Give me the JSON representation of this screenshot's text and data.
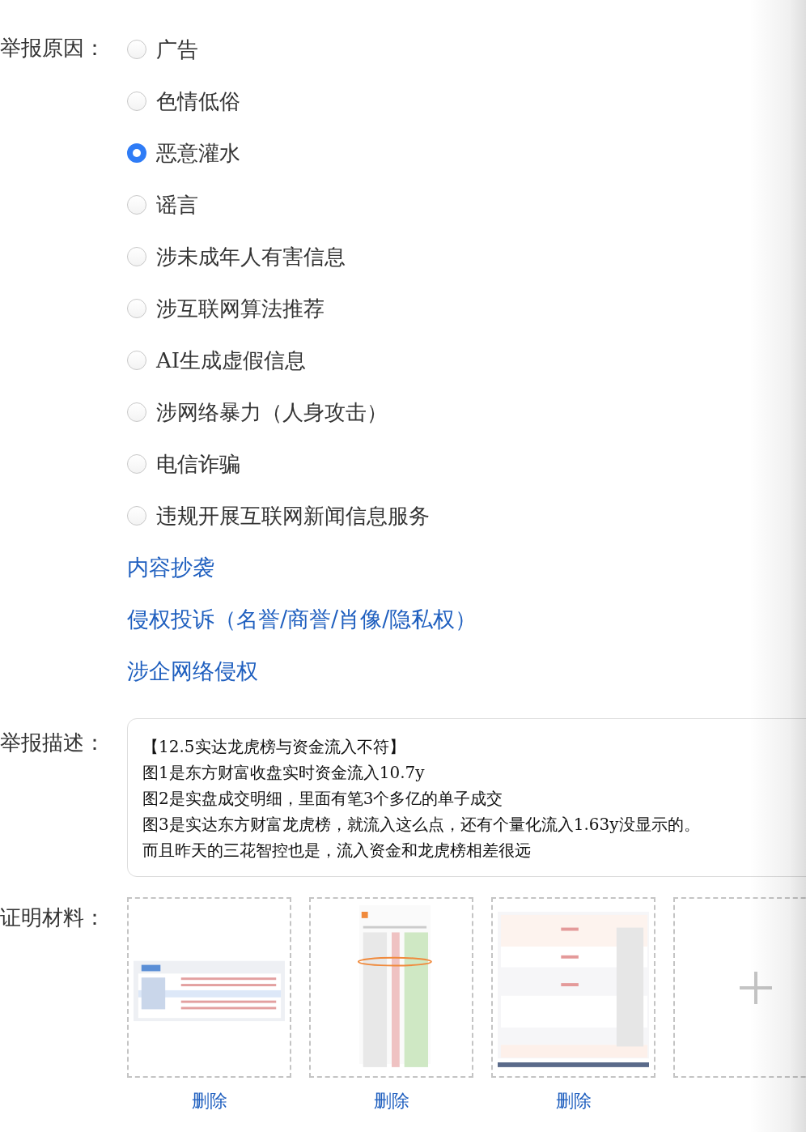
{
  "report_reason": {
    "label": "举报原因：",
    "options": [
      {
        "label": "广告",
        "kind": "radio",
        "selected": false
      },
      {
        "label": "色情低俗",
        "kind": "radio",
        "selected": false
      },
      {
        "label": "恶意灌水",
        "kind": "radio",
        "selected": true
      },
      {
        "label": "谣言",
        "kind": "radio",
        "selected": false
      },
      {
        "label": "涉未成年人有害信息",
        "kind": "radio",
        "selected": false
      },
      {
        "label": "涉互联网算法推荐",
        "kind": "radio",
        "selected": false
      },
      {
        "label": "AI生成虚假信息",
        "kind": "radio",
        "selected": false
      },
      {
        "label": "涉网络暴力（人身攻击）",
        "kind": "radio",
        "selected": false
      },
      {
        "label": "电信诈骗",
        "kind": "radio",
        "selected": false
      },
      {
        "label": "违规开展互联网新闻信息服务",
        "kind": "radio",
        "selected": false
      },
      {
        "label": "内容抄袭",
        "kind": "link"
      },
      {
        "label": "侵权投诉（名誉/商誉/肖像/隐私权）",
        "kind": "link"
      },
      {
        "label": "涉企网络侵权",
        "kind": "link"
      }
    ]
  },
  "description": {
    "label": "举报描述：",
    "lines": [
      "【12.5实达龙虎榜与资金流入不符】",
      "图1是东方财富收盘实时资金流入10.7y",
      "图2是实盘成交明细，里面有笔3个多亿的单子成交",
      "图3是实达东方财富龙虎榜，就流入这么点，还有个量化流入1.63y没显示的。",
      "而且昨天的三花智控也是，流入资金和龙虎榜相差很远"
    ]
  },
  "evidence": {
    "label": "证明材料：",
    "images": [
      {
        "kind": "picture",
        "delete": "删除"
      },
      {
        "kind": "picture",
        "delete": "删除"
      },
      {
        "kind": "picture",
        "delete": "删除"
      }
    ]
  }
}
